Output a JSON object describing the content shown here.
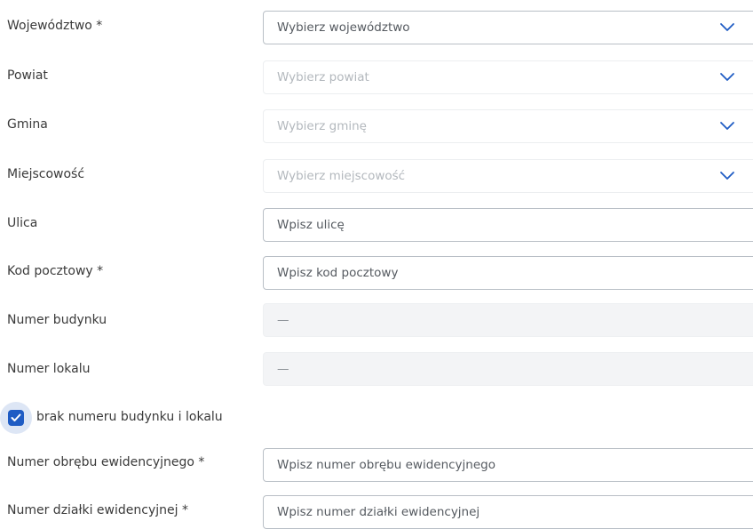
{
  "form": {
    "wojewodztwo": {
      "label": "Województwo *",
      "placeholder": "Wybierz województwo"
    },
    "powiat": {
      "label": "Powiat",
      "placeholder": "Wybierz powiat"
    },
    "gmina": {
      "label": "Gmina",
      "placeholder": "Wybierz gminę"
    },
    "miejscowosc": {
      "label": "Miejscowość",
      "placeholder": "Wybierz miejscowość"
    },
    "ulica": {
      "label": "Ulica",
      "placeholder": "Wpisz ulicę"
    },
    "kod_pocztowy": {
      "label": "Kod pocztowy *",
      "placeholder": "Wpisz kod pocztowy"
    },
    "numer_budynku": {
      "label": "Numer budynku",
      "value": "—"
    },
    "numer_lokalu": {
      "label": "Numer lokalu",
      "value": "—"
    },
    "brak_numeru": {
      "label": "brak numeru budynku i lokalu",
      "checked": true
    },
    "numer_obrebu": {
      "label": "Numer obrębu ewidencyjnego *",
      "placeholder": "Wpisz numer obrębu ewidencyjnego"
    },
    "numer_dzialki": {
      "label": "Numer działki ewidencyjnej *",
      "placeholder": "Wpisz numer działki ewidencyjnej"
    }
  },
  "icons": {
    "select_arrow": "chevron-down-icon",
    "checkbox_mark": "checkmark-icon"
  },
  "colors": {
    "accent": "#1f5cc4",
    "border": "#b9bfc6",
    "disabled_bg": "#f3f4f6",
    "checkbox_halo": "#dde6f5"
  }
}
